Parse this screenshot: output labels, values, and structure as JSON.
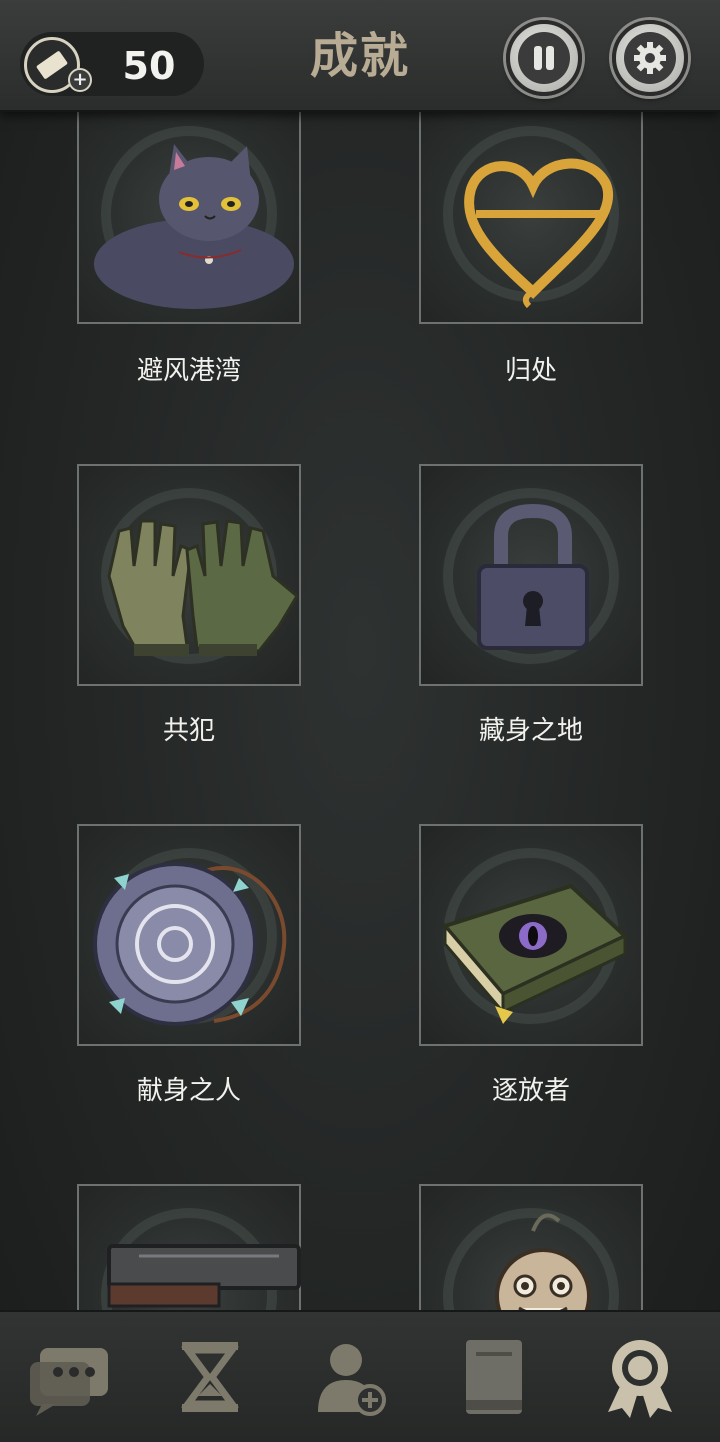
{
  "header": {
    "title": "成就",
    "ticket_count": "50"
  },
  "achievements": [
    {
      "label": "避风港湾",
      "icon": "cat-icon"
    },
    {
      "label": "归处",
      "icon": "golden-heart-icon"
    },
    {
      "label": "共犯",
      "icon": "gloves-icon"
    },
    {
      "label": "藏身之地",
      "icon": "padlock-icon"
    },
    {
      "label": "献身之人",
      "icon": "amulet-icon"
    },
    {
      "label": "逐放者",
      "icon": "eye-book-icon"
    },
    {
      "label": "",
      "icon": "pistol-icon"
    },
    {
      "label": "",
      "icon": "doll-head-icon"
    }
  ],
  "nav": {
    "items": [
      "chat-icon",
      "hourglass-icon",
      "add-contact-icon",
      "book-icon",
      "award-ribbon-icon"
    ],
    "active": "award-ribbon-icon"
  },
  "colors": {
    "title": "#b8ac94",
    "nav_icon": "#7d7a6b",
    "nav_active": "#c9c1ab"
  }
}
